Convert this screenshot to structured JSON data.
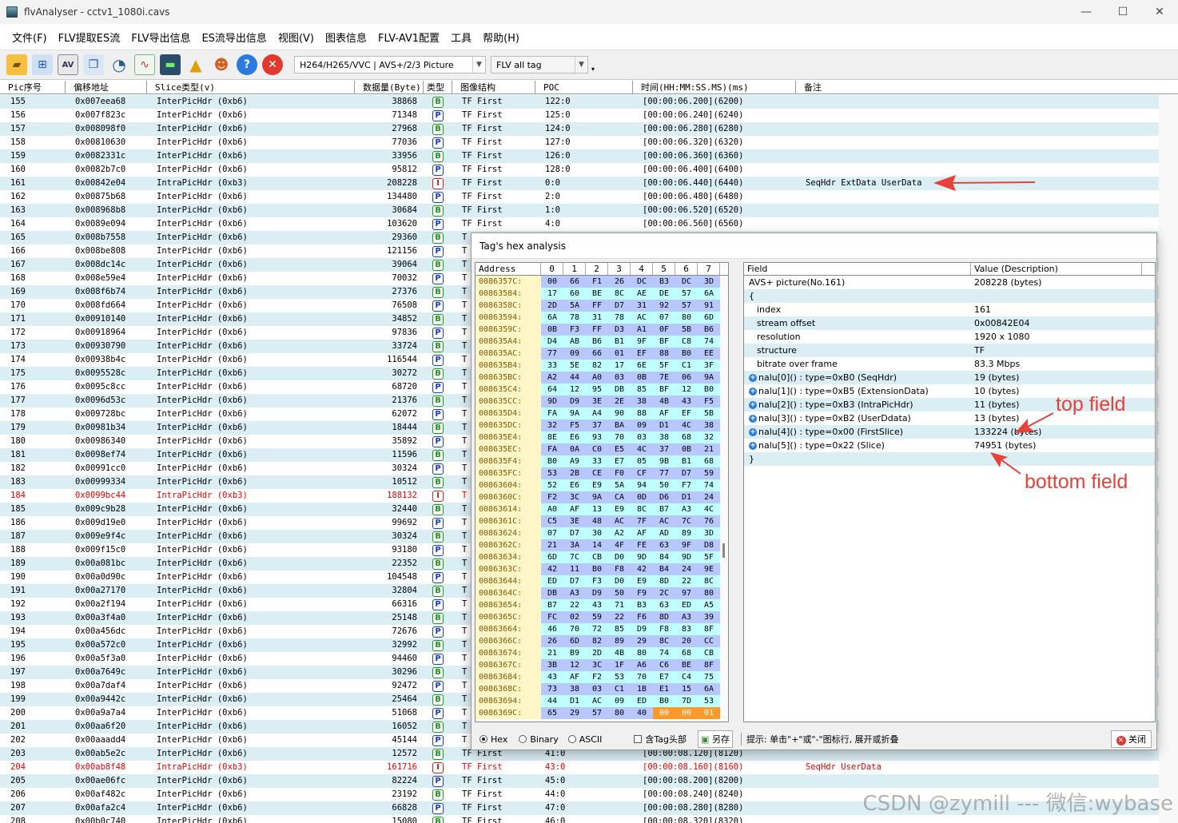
{
  "window": {
    "title": "flvAnalyser - cctv1_1080i.cavs",
    "controls": [
      "—",
      "☐",
      "✕"
    ]
  },
  "menu": [
    "文件(F)",
    "FLV提取ES流",
    "FLV导出信息",
    "ES流导出信息",
    "视图(V)",
    "图表信息",
    "FLV-AV1配置",
    "工具",
    "帮助(H)"
  ],
  "toolbar": {
    "icons": [
      "open-folder-icon",
      "network-icon",
      "av-icon",
      "copy-icon",
      "clock-icon",
      "chart-icon",
      "monitor-icon",
      "warning-icon",
      "user-icon",
      "help-icon",
      "close-circle-icon"
    ],
    "codec_select": "H264/H265/VVC | AVS+/2/3 Picture",
    "tag_select": "FLV all tag"
  },
  "grid": {
    "columns": [
      "Pic序号",
      "偏移地址",
      "Slice类型(v)",
      "数据量(Byte)",
      "类型",
      "图像结构",
      "POC",
      "时间(HH:MM:SS.MS)(ms)",
      "备注"
    ],
    "rows": [
      [
        "155",
        "0x007eea68",
        "InterPicHdr (0xb6)",
        "38868",
        "B",
        "TF First",
        "122:0",
        "[00:00:06.200](6200)",
        ""
      ],
      [
        "156",
        "0x007f823c",
        "InterPicHdr (0xb6)",
        "71348",
        "P",
        "TF First",
        "125:0",
        "[00:00:06.240](6240)",
        ""
      ],
      [
        "157",
        "0x008098f0",
        "InterPicHdr (0xb6)",
        "27968",
        "B",
        "TF First",
        "124:0",
        "[00:00:06.280](6280)",
        ""
      ],
      [
        "158",
        "0x00810630",
        "InterPicHdr (0xb6)",
        "77036",
        "P",
        "TF First",
        "127:0",
        "[00:00:06.320](6320)",
        ""
      ],
      [
        "159",
        "0x0082331c",
        "InterPicHdr (0xb6)",
        "33956",
        "B",
        "TF First",
        "126:0",
        "[00:00:06.360](6360)",
        ""
      ],
      [
        "160",
        "0x0082b7c0",
        "InterPicHdr (0xb6)",
        "95812",
        "P",
        "TF First",
        "128:0",
        "[00:00:06.400](6400)",
        ""
      ],
      [
        "161",
        "0x00842e04",
        "IntraPicHdr (0xb3)",
        "208228",
        "I",
        "TF First",
        "0:0",
        "[00:00:06.440](6440)",
        "SeqHdr ExtData UserData"
      ],
      [
        "162",
        "0x00875b68",
        "InterPicHdr (0xb6)",
        "134480",
        "P",
        "TF First",
        "2:0",
        "[00:00:06.480](6480)",
        ""
      ],
      [
        "163",
        "0x008968b8",
        "InterPicHdr (0xb6)",
        "30684",
        "B",
        "TF First",
        "1:0",
        "[00:00:06.520](6520)",
        ""
      ],
      [
        "164",
        "0x0089e094",
        "InterPicHdr (0xb6)",
        "103620",
        "P",
        "TF First",
        "4:0",
        "[00:00:06.560](6560)",
        ""
      ],
      [
        "165",
        "0x008b7558",
        "InterPicHdr (0xb6)",
        "29360",
        "B",
        "T",
        "",
        "",
        ""
      ],
      [
        "166",
        "0x008be808",
        "InterPicHdr (0xb6)",
        "121156",
        "P",
        "T",
        "",
        "",
        ""
      ],
      [
        "167",
        "0x008dc14c",
        "InterPicHdr (0xb6)",
        "39064",
        "B",
        "T",
        "",
        "",
        ""
      ],
      [
        "168",
        "0x008e59e4",
        "InterPicHdr (0xb6)",
        "70032",
        "P",
        "T",
        "",
        "",
        ""
      ],
      [
        "169",
        "0x008f6b74",
        "InterPicHdr (0xb6)",
        "27376",
        "B",
        "T",
        "",
        "",
        ""
      ],
      [
        "170",
        "0x008fd664",
        "InterPicHdr (0xb6)",
        "76508",
        "P",
        "T",
        "",
        "",
        ""
      ],
      [
        "171",
        "0x00910140",
        "InterPicHdr (0xb6)",
        "34852",
        "B",
        "T",
        "",
        "",
        ""
      ],
      [
        "172",
        "0x00918964",
        "InterPicHdr (0xb6)",
        "97836",
        "P",
        "T",
        "",
        "",
        ""
      ],
      [
        "173",
        "0x00930790",
        "InterPicHdr (0xb6)",
        "33724",
        "B",
        "T",
        "",
        "",
        ""
      ],
      [
        "174",
        "0x00938b4c",
        "InterPicHdr (0xb6)",
        "116544",
        "P",
        "T",
        "",
        "",
        ""
      ],
      [
        "175",
        "0x0095528c",
        "InterPicHdr (0xb6)",
        "30272",
        "B",
        "T",
        "",
        "",
        ""
      ],
      [
        "176",
        "0x0095c8cc",
        "InterPicHdr (0xb6)",
        "68720",
        "P",
        "T",
        "",
        "",
        ""
      ],
      [
        "177",
        "0x0096d53c",
        "InterPicHdr (0xb6)",
        "21376",
        "B",
        "T",
        "",
        "",
        ""
      ],
      [
        "178",
        "0x009728bc",
        "InterPicHdr (0xb6)",
        "62072",
        "P",
        "T",
        "",
        "",
        ""
      ],
      [
        "179",
        "0x00981b34",
        "InterPicHdr (0xb6)",
        "18444",
        "B",
        "T",
        "",
        "",
        ""
      ],
      [
        "180",
        "0x00986340",
        "InterPicHdr (0xb6)",
        "35892",
        "P",
        "T",
        "",
        "",
        ""
      ],
      [
        "181",
        "0x0098ef74",
        "InterPicHdr (0xb6)",
        "11596",
        "B",
        "T",
        "",
        "",
        ""
      ],
      [
        "182",
        "0x00991cc0",
        "InterPicHdr (0xb6)",
        "30324",
        "P",
        "T",
        "",
        "",
        ""
      ],
      [
        "183",
        "0x00999334",
        "InterPicHdr (0xb6)",
        "10512",
        "B",
        "T",
        "",
        "",
        ""
      ],
      [
        "184",
        "0x0099bc44",
        "IntraPicHdr (0xb3)",
        "188132",
        "I",
        "T",
        "",
        "",
        ""
      ],
      [
        "185",
        "0x009c9b28",
        "InterPicHdr (0xb6)",
        "32440",
        "B",
        "T",
        "",
        "",
        ""
      ],
      [
        "186",
        "0x009d19e0",
        "InterPicHdr (0xb6)",
        "99692",
        "P",
        "T",
        "",
        "",
        ""
      ],
      [
        "187",
        "0x009e9f4c",
        "InterPicHdr (0xb6)",
        "30324",
        "B",
        "T",
        "",
        "",
        ""
      ],
      [
        "188",
        "0x009f15c0",
        "InterPicHdr (0xb6)",
        "93180",
        "P",
        "T",
        "",
        "",
        ""
      ],
      [
        "189",
        "0x00a081bc",
        "InterPicHdr (0xb6)",
        "22352",
        "B",
        "T",
        "",
        "",
        ""
      ],
      [
        "190",
        "0x00a0d90c",
        "InterPicHdr (0xb6)",
        "104548",
        "P",
        "T",
        "",
        "",
        ""
      ],
      [
        "191",
        "0x00a27170",
        "InterPicHdr (0xb6)",
        "32804",
        "B",
        "T",
        "",
        "",
        ""
      ],
      [
        "192",
        "0x00a2f194",
        "InterPicHdr (0xb6)",
        "66316",
        "P",
        "T",
        "",
        "",
        ""
      ],
      [
        "193",
        "0x00a3f4a0",
        "InterPicHdr (0xb6)",
        "25148",
        "B",
        "T",
        "",
        "",
        ""
      ],
      [
        "194",
        "0x00a456dc",
        "InterPicHdr (0xb6)",
        "72676",
        "P",
        "T",
        "",
        "",
        ""
      ],
      [
        "195",
        "0x00a572c0",
        "InterPicHdr (0xb6)",
        "32992",
        "B",
        "T",
        "",
        "",
        ""
      ],
      [
        "196",
        "0x00a5f3a0",
        "InterPicHdr (0xb6)",
        "94460",
        "P",
        "T",
        "",
        "",
        ""
      ],
      [
        "197",
        "0x00a7649c",
        "InterPicHdr (0xb6)",
        "30296",
        "B",
        "T",
        "",
        "",
        ""
      ],
      [
        "198",
        "0x00a7daf4",
        "InterPicHdr (0xb6)",
        "92472",
        "P",
        "T",
        "",
        "",
        ""
      ],
      [
        "199",
        "0x00a9442c",
        "InterPicHdr (0xb6)",
        "25464",
        "B",
        "T",
        "",
        "",
        ""
      ],
      [
        "200",
        "0x00a9a7a4",
        "InterPicHdr (0xb6)",
        "51068",
        "P",
        "T",
        "",
        "",
        ""
      ],
      [
        "201",
        "0x00aa6f20",
        "InterPicHdr (0xb6)",
        "16052",
        "B",
        "T",
        "",
        "",
        ""
      ],
      [
        "202",
        "0x00aaadd4",
        "InterPicHdr (0xb6)",
        "45144",
        "P",
        "T",
        "",
        "",
        ""
      ],
      [
        "203",
        "0x00ab5e2c",
        "InterPicHdr (0xb6)",
        "12572",
        "B",
        "TF First",
        "41:0",
        "[00:00:08.120](8120)",
        ""
      ],
      [
        "204",
        "0x00ab8f48",
        "IntraPicHdr (0xb3)",
        "161716",
        "I",
        "TF First",
        "43:0",
        "[00:00:08.160](8160)",
        "SeqHdr UserData"
      ],
      [
        "205",
        "0x00ae06fc",
        "InterPicHdr (0xb6)",
        "82224",
        "P",
        "TF First",
        "45:0",
        "[00:00:08.200](8200)",
        ""
      ],
      [
        "206",
        "0x00af482c",
        "InterPicHdr (0xb6)",
        "23192",
        "B",
        "TF First",
        "44:0",
        "[00:00:08.240](8240)",
        ""
      ],
      [
        "207",
        "0x00afa2c4",
        "InterPicHdr (0xb6)",
        "66828",
        "P",
        "TF First",
        "47:0",
        "[00:00:08.280](8280)",
        ""
      ],
      [
        "208",
        "0x00b0c740",
        "InterPicHdr (0xb6)",
        "15080",
        "B",
        "TF First",
        "46:0",
        "[00:00:08.320](8320)",
        ""
      ]
    ]
  },
  "dialog": {
    "title": "Tag's hex analysis",
    "hex": {
      "headers": [
        "Address",
        "0",
        "1",
        "2",
        "3",
        "4",
        "5",
        "6",
        "7"
      ],
      "rows": [
        [
          "0086357C:",
          "00",
          "66",
          "F1",
          "26",
          "DC",
          "B3",
          "DC",
          "3D"
        ],
        [
          "00863584:",
          "17",
          "60",
          "BE",
          "8C",
          "AE",
          "DE",
          "57",
          "6A"
        ],
        [
          "0086358C:",
          "2D",
          "5A",
          "FF",
          "D7",
          "31",
          "92",
          "57",
          "91"
        ],
        [
          "00863594:",
          "6A",
          "78",
          "31",
          "78",
          "AC",
          "07",
          "80",
          "6D"
        ],
        [
          "0086359C:",
          "0B",
          "F3",
          "FF",
          "D3",
          "A1",
          "0F",
          "5B",
          "B6"
        ],
        [
          "008635A4:",
          "D4",
          "AB",
          "B6",
          "B1",
          "9F",
          "BF",
          "C8",
          "74"
        ],
        [
          "008635AC:",
          "77",
          "09",
          "66",
          "01",
          "EF",
          "88",
          "B0",
          "EE"
        ],
        [
          "008635B4:",
          "33",
          "5E",
          "82",
          "17",
          "6E",
          "5F",
          "C1",
          "3F"
        ],
        [
          "008635BC:",
          "A2",
          "44",
          "A0",
          "03",
          "0B",
          "7E",
          "06",
          "9A"
        ],
        [
          "008635C4:",
          "64",
          "12",
          "95",
          "DB",
          "85",
          "BF",
          "12",
          "B0"
        ],
        [
          "008635CC:",
          "9D",
          "D9",
          "3E",
          "2E",
          "38",
          "4B",
          "43",
          "F5"
        ],
        [
          "008635D4:",
          "FA",
          "9A",
          "A4",
          "90",
          "88",
          "AF",
          "EF",
          "5B"
        ],
        [
          "008635DC:",
          "32",
          "F5",
          "37",
          "BA",
          "09",
          "D1",
          "4C",
          "38"
        ],
        [
          "008635E4:",
          "8E",
          "E6",
          "93",
          "70",
          "03",
          "38",
          "68",
          "32"
        ],
        [
          "008635EC:",
          "FA",
          "0A",
          "C0",
          "E5",
          "4C",
          "37",
          "0B",
          "21"
        ],
        [
          "008635F4:",
          "B0",
          "A9",
          "33",
          "E7",
          "05",
          "9B",
          "B1",
          "68"
        ],
        [
          "008635FC:",
          "53",
          "2B",
          "CE",
          "F0",
          "CF",
          "77",
          "D7",
          "59"
        ],
        [
          "00863604:",
          "52",
          "E6",
          "E9",
          "5A",
          "94",
          "50",
          "F7",
          "74"
        ],
        [
          "0086360C:",
          "F2",
          "3C",
          "9A",
          "CA",
          "0D",
          "D6",
          "D1",
          "24"
        ],
        [
          "00863614:",
          "A0",
          "AF",
          "13",
          "E9",
          "8C",
          "B7",
          "A3",
          "4C"
        ],
        [
          "0086361C:",
          "C5",
          "3E",
          "48",
          "AC",
          "7F",
          "AC",
          "7C",
          "76"
        ],
        [
          "00863624:",
          "07",
          "D7",
          "30",
          "A2",
          "AF",
          "AD",
          "89",
          "3D"
        ],
        [
          "0086362C:",
          "21",
          "3A",
          "14",
          "4F",
          "FE",
          "63",
          "9F",
          "D8"
        ],
        [
          "00863634:",
          "6D",
          "7C",
          "CB",
          "D0",
          "9D",
          "84",
          "9D",
          "5F"
        ],
        [
          "0086363C:",
          "42",
          "11",
          "B0",
          "F8",
          "42",
          "B4",
          "24",
          "9E"
        ],
        [
          "00863644:",
          "ED",
          "D7",
          "F3",
          "D0",
          "E9",
          "8D",
          "22",
          "8C"
        ],
        [
          "0086364C:",
          "DB",
          "A3",
          "D9",
          "50",
          "F9",
          "2C",
          "97",
          "80"
        ],
        [
          "00863654:",
          "B7",
          "22",
          "43",
          "71",
          "B3",
          "63",
          "ED",
          "A5"
        ],
        [
          "0086365C:",
          "FC",
          "02",
          "59",
          "22",
          "F6",
          "8D",
          "A3",
          "39"
        ],
        [
          "00863664:",
          "46",
          "70",
          "72",
          "85",
          "D9",
          "F8",
          "83",
          "8F"
        ],
        [
          "0086366C:",
          "26",
          "6D",
          "82",
          "89",
          "29",
          "8C",
          "20",
          "CC"
        ],
        [
          "00863674:",
          "21",
          "B9",
          "2D",
          "4B",
          "80",
          "74",
          "68",
          "CB"
        ],
        [
          "0086367C:",
          "3B",
          "12",
          "3C",
          "1F",
          "A6",
          "C6",
          "BE",
          "8F"
        ],
        [
          "00863684:",
          "43",
          "AF",
          "F2",
          "53",
          "70",
          "E7",
          "C4",
          "75"
        ],
        [
          "0086368C:",
          "73",
          "38",
          "03",
          "C1",
          "1B",
          "E1",
          "15",
          "6A"
        ],
        [
          "00863694:",
          "44",
          "D1",
          "AC",
          "09",
          "ED",
          "B0",
          "7D",
          "53"
        ],
        [
          "0086369C:",
          "65",
          "29",
          "57",
          "80",
          "40",
          "00",
          "00",
          "01"
        ]
      ]
    },
    "fields": {
      "headers": [
        "Field",
        "Value (Description)"
      ],
      "rows": [
        {
          "field": "AVS+ picture(No.161)",
          "value": "208228 (bytes)",
          "indent": 0,
          "expand": false
        },
        {
          "field": "{",
          "value": "",
          "indent": 0,
          "expand": false
        },
        {
          "field": "index",
          "value": "161",
          "indent": 1,
          "expand": false
        },
        {
          "field": "stream offset",
          "value": "0x00842E04",
          "indent": 1,
          "expand": false
        },
        {
          "field": "resolution",
          "value": "1920 x 1080",
          "indent": 1,
          "expand": false
        },
        {
          "field": "structure",
          "value": "TF",
          "indent": 1,
          "expand": false
        },
        {
          "field": "bitrate over frame",
          "value": "83.3 Mbps",
          "indent": 1,
          "expand": false
        },
        {
          "field": "nalu[0]() : type=0xB0 (SeqHdr)",
          "value": "19 (bytes)",
          "indent": 1,
          "expand": true
        },
        {
          "field": "nalu[1]() : type=0xB5 (ExtensionData)",
          "value": "10 (bytes)",
          "indent": 1,
          "expand": true
        },
        {
          "field": "nalu[2]() : type=0xB3 (IntraPicHdr)",
          "value": "11 (bytes)",
          "indent": 1,
          "expand": true
        },
        {
          "field": "nalu[3]() : type=0xB2 (UserDdata)",
          "value": "13 (bytes)",
          "indent": 1,
          "expand": true
        },
        {
          "field": "nalu[4]() : type=0x00 (FirstSlice)",
          "value": "133224 (bytes)",
          "indent": 1,
          "expand": true
        },
        {
          "field": "nalu[5]() : type=0x22 (Slice)",
          "value": "74951 (bytes)",
          "indent": 1,
          "expand": true
        },
        {
          "field": "}",
          "value": "",
          "indent": 0,
          "expand": false
        }
      ]
    },
    "footer": {
      "radio_hex": "Hex",
      "radio_binary": "Binary",
      "radio_ascii": "ASCII",
      "checkbox_tag_header": "含Tag头部",
      "save_as": "另存",
      "hint": "提示: 单击\"+\"或\"-\"图标行, 展开或折叠",
      "close": "关闭"
    }
  },
  "annotations": {
    "top_field": "top field",
    "bottom_field": "bottom field",
    "color": "#e8413a"
  },
  "watermark": "CSDN @zymill --- 微信:wybase"
}
